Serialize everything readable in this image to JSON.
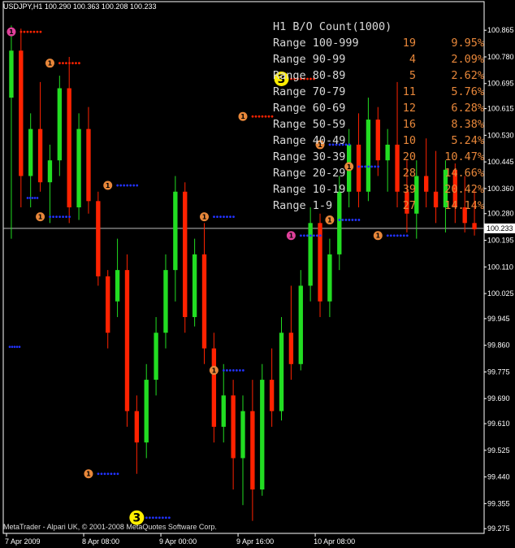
{
  "header": {
    "symbol_ohlc": "USDJPY,H1  100.290  100.363  100.208  100.233"
  },
  "stats": {
    "title": "H1 B/O Count(1000)",
    "rows": [
      {
        "label": "Range 100-999",
        "count": "19",
        "pct": "9.95%"
      },
      {
        "label": "Range 90-99",
        "count": "4",
        "pct": "2.09%"
      },
      {
        "label": "Range 80-89",
        "count": "5",
        "pct": "2.62%"
      },
      {
        "label": "Range 70-79",
        "count": "11",
        "pct": "5.76%"
      },
      {
        "label": "Range 60-69",
        "count": "12",
        "pct": "6.28%"
      },
      {
        "label": "Range 50-59",
        "count": "16",
        "pct": "8.38%"
      },
      {
        "label": "Range 40-49",
        "count": "10",
        "pct": "5.24%"
      },
      {
        "label": "Range 30-39",
        "count": "20",
        "pct": "10.47%"
      },
      {
        "label": "Range 20-29",
        "count": "28",
        "pct": "14.66%"
      },
      {
        "label": "Range 10-19",
        "count": "39",
        "pct": "20.42%"
      },
      {
        "label": "Range 1-9",
        "count": "27",
        "pct": "14.14%"
      }
    ]
  },
  "colors": {
    "background": "#000000",
    "bull": "#22dd22",
    "bear": "#ff2200",
    "marker_orange": "#e8873a",
    "marker_yellow": "#ffee00",
    "marker_pink": "#e0409a",
    "dots_red": "#ff2200",
    "dots_blue": "#2233ff",
    "current_line": "#bbbbbb"
  },
  "price_axis": {
    "ticks": [
      "100.865",
      "100.780",
      "100.695",
      "100.615",
      "100.530",
      "100.445",
      "100.360",
      "100.280",
      "100.195",
      "100.110",
      "100.025",
      "99.945",
      "99.860",
      "99.775",
      "99.690",
      "99.610",
      "99.525",
      "99.440",
      "99.355",
      "99.275"
    ],
    "current_price": "100.233"
  },
  "time_axis": {
    "ticks": [
      "7 Apr 2009",
      "8 Apr 08:00",
      "9 Apr 00:00",
      "9 Apr 16:00",
      "10 Apr 08:00"
    ]
  },
  "copyright": "MetaTrader - Alpari UK, © 2001-2008 MetaQuotes Software Corp.",
  "chart_data": {
    "type": "candlestick",
    "symbol": "USDJPY",
    "timeframe": "H1",
    "ylim": [
      99.26,
      100.92
    ],
    "candles": [
      [
        100.65,
        100.88,
        100.2,
        100.8
      ],
      [
        100.8,
        100.87,
        100.3,
        100.4
      ],
      [
        100.4,
        100.6,
        100.3,
        100.55
      ],
      [
        100.55,
        100.7,
        100.35,
        100.38
      ],
      [
        100.38,
        100.5,
        100.25,
        100.45
      ],
      [
        100.45,
        100.72,
        100.4,
        100.68
      ],
      [
        100.68,
        100.78,
        100.25,
        100.3
      ],
      [
        100.3,
        100.6,
        100.26,
        100.55
      ],
      [
        100.55,
        100.62,
        100.28,
        100.32
      ],
      [
        100.32,
        100.35,
        100.05,
        100.08
      ],
      [
        100.08,
        100.1,
        99.85,
        99.9
      ],
      [
        100.0,
        100.2,
        99.95,
        100.1
      ],
      [
        100.1,
        100.15,
        99.6,
        99.65
      ],
      [
        99.65,
        99.7,
        99.45,
        99.55
      ],
      [
        99.55,
        99.8,
        99.5,
        99.75
      ],
      [
        99.75,
        99.95,
        99.7,
        99.9
      ],
      [
        99.9,
        100.15,
        99.85,
        100.1
      ],
      [
        100.1,
        100.4,
        100.0,
        100.35
      ],
      [
        100.35,
        100.38,
        99.9,
        99.95
      ],
      [
        99.95,
        100.2,
        99.92,
        100.15
      ],
      [
        100.15,
        100.25,
        99.8,
        99.85
      ],
      [
        99.85,
        99.9,
        99.55,
        99.6
      ],
      [
        99.6,
        99.8,
        99.55,
        99.7
      ],
      [
        99.7,
        99.75,
        99.4,
        99.5
      ],
      [
        99.5,
        99.7,
        99.35,
        99.65
      ],
      [
        99.65,
        99.75,
        99.3,
        99.4
      ],
      [
        99.4,
        99.8,
        99.38,
        99.75
      ],
      [
        99.75,
        99.85,
        99.6,
        99.65
      ],
      [
        99.65,
        99.95,
        99.62,
        99.9
      ],
      [
        99.9,
        100.05,
        99.75,
        99.8
      ],
      [
        99.8,
        100.1,
        99.78,
        100.05
      ],
      [
        100.05,
        100.3,
        100.0,
        100.25
      ],
      [
        100.25,
        100.28,
        99.95,
        100.0
      ],
      [
        100.0,
        100.2,
        99.95,
        100.15
      ],
      [
        100.15,
        100.4,
        100.1,
        100.35
      ],
      [
        100.35,
        100.55,
        100.3,
        100.5
      ],
      [
        100.5,
        100.6,
        100.3,
        100.35
      ],
      [
        100.35,
        100.65,
        100.32,
        100.58
      ],
      [
        100.58,
        100.62,
        100.4,
        100.45
      ],
      [
        100.45,
        100.55,
        100.35,
        100.5
      ],
      [
        100.5,
        100.7,
        100.3,
        100.35
      ],
      [
        100.35,
        100.45,
        100.22,
        100.28
      ],
      [
        100.28,
        100.45,
        100.2,
        100.4
      ],
      [
        100.4,
        100.52,
        100.3,
        100.35
      ],
      [
        100.35,
        100.48,
        100.25,
        100.3
      ],
      [
        100.3,
        100.45,
        100.22,
        100.42
      ],
      [
        100.42,
        100.44,
        100.25,
        100.3
      ],
      [
        100.3,
        100.4,
        100.22,
        100.25
      ],
      [
        100.25,
        100.36,
        100.21,
        100.23
      ]
    ],
    "markers": [
      {
        "label": "1",
        "color": "pink",
        "price": 100.86,
        "bar": 0
      },
      {
        "label": "1",
        "color": "orange",
        "price": 100.76,
        "bar": 4
      },
      {
        "label": "1",
        "color": "orange",
        "price": 100.27,
        "bar": 3
      },
      {
        "label": "1",
        "color": "orange",
        "price": 100.37,
        "bar": 10
      },
      {
        "label": "1",
        "color": "orange",
        "price": 100.27,
        "bar": 20
      },
      {
        "label": "1",
        "color": "orange",
        "price": 100.59,
        "bar": 24
      },
      {
        "label": "3",
        "color": "yellow",
        "price": 100.71,
        "bar": 28
      },
      {
        "label": "1",
        "color": "orange",
        "price": 100.5,
        "bar": 32
      },
      {
        "label": "1",
        "color": "orange",
        "price": 100.43,
        "bar": 35
      },
      {
        "label": "1",
        "color": "pink",
        "price": 100.21,
        "bar": 29
      },
      {
        "label": "1",
        "color": "orange",
        "price": 100.26,
        "bar": 33
      },
      {
        "label": "1",
        "color": "orange",
        "price": 100.21,
        "bar": 38
      },
      {
        "label": "1",
        "color": "orange",
        "price": 99.78,
        "bar": 21
      },
      {
        "label": "1",
        "color": "orange",
        "price": 99.45,
        "bar": 8
      },
      {
        "label": "3",
        "color": "yellow",
        "price": 99.31,
        "bar": 13
      }
    ]
  }
}
